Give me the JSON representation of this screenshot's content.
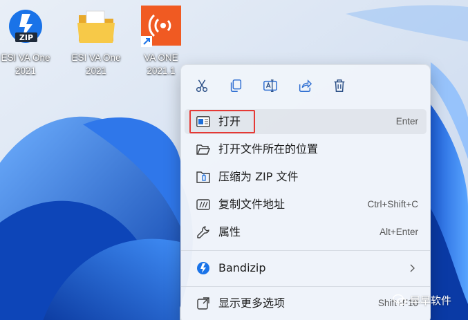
{
  "desktop": {
    "icons": [
      {
        "line1": "ESI VA One",
        "line2": "2021",
        "icon": "zip-archive-icon"
      },
      {
        "line1": "ESI VA One",
        "line2": "2021",
        "icon": "folder-icon"
      },
      {
        "line1": "VA ONE",
        "line2": "2021.1",
        "icon": "va-one-app-icon"
      }
    ]
  },
  "context_menu": {
    "quick_actions": [
      {
        "name": "cut",
        "icon": "scissors-icon"
      },
      {
        "name": "copy",
        "icon": "copy-icon"
      },
      {
        "name": "rename",
        "icon": "rename-icon"
      },
      {
        "name": "share",
        "icon": "share-icon"
      },
      {
        "name": "delete",
        "icon": "trash-icon"
      }
    ],
    "items": [
      {
        "label": "打开",
        "shortcut": "Enter",
        "icon": "open-window-icon",
        "highlighted": true
      },
      {
        "label": "打开文件所在的位置",
        "shortcut": "",
        "icon": "folder-open-icon"
      },
      {
        "label": "压缩为 ZIP 文件",
        "shortcut": "",
        "icon": "zip-folder-icon"
      },
      {
        "label": "复制文件地址",
        "shortcut": "Ctrl+Shift+C",
        "icon": "copy-path-icon"
      },
      {
        "label": "属性",
        "shortcut": "Alt+Enter",
        "icon": "wrench-icon"
      },
      {
        "label": "Bandizip",
        "shortcut": "",
        "icon": "bandizip-icon",
        "submenu": true
      },
      {
        "label": "显示更多选项",
        "shortcut": "Shift+F10",
        "icon": "more-options-icon"
      }
    ]
  },
  "watermark": {
    "text": "早早软件",
    "icon": "wechat-icon"
  },
  "colors": {
    "accent": "#0f6cd9",
    "highlight_border": "#e53935",
    "va_orange": "#f05a22"
  }
}
